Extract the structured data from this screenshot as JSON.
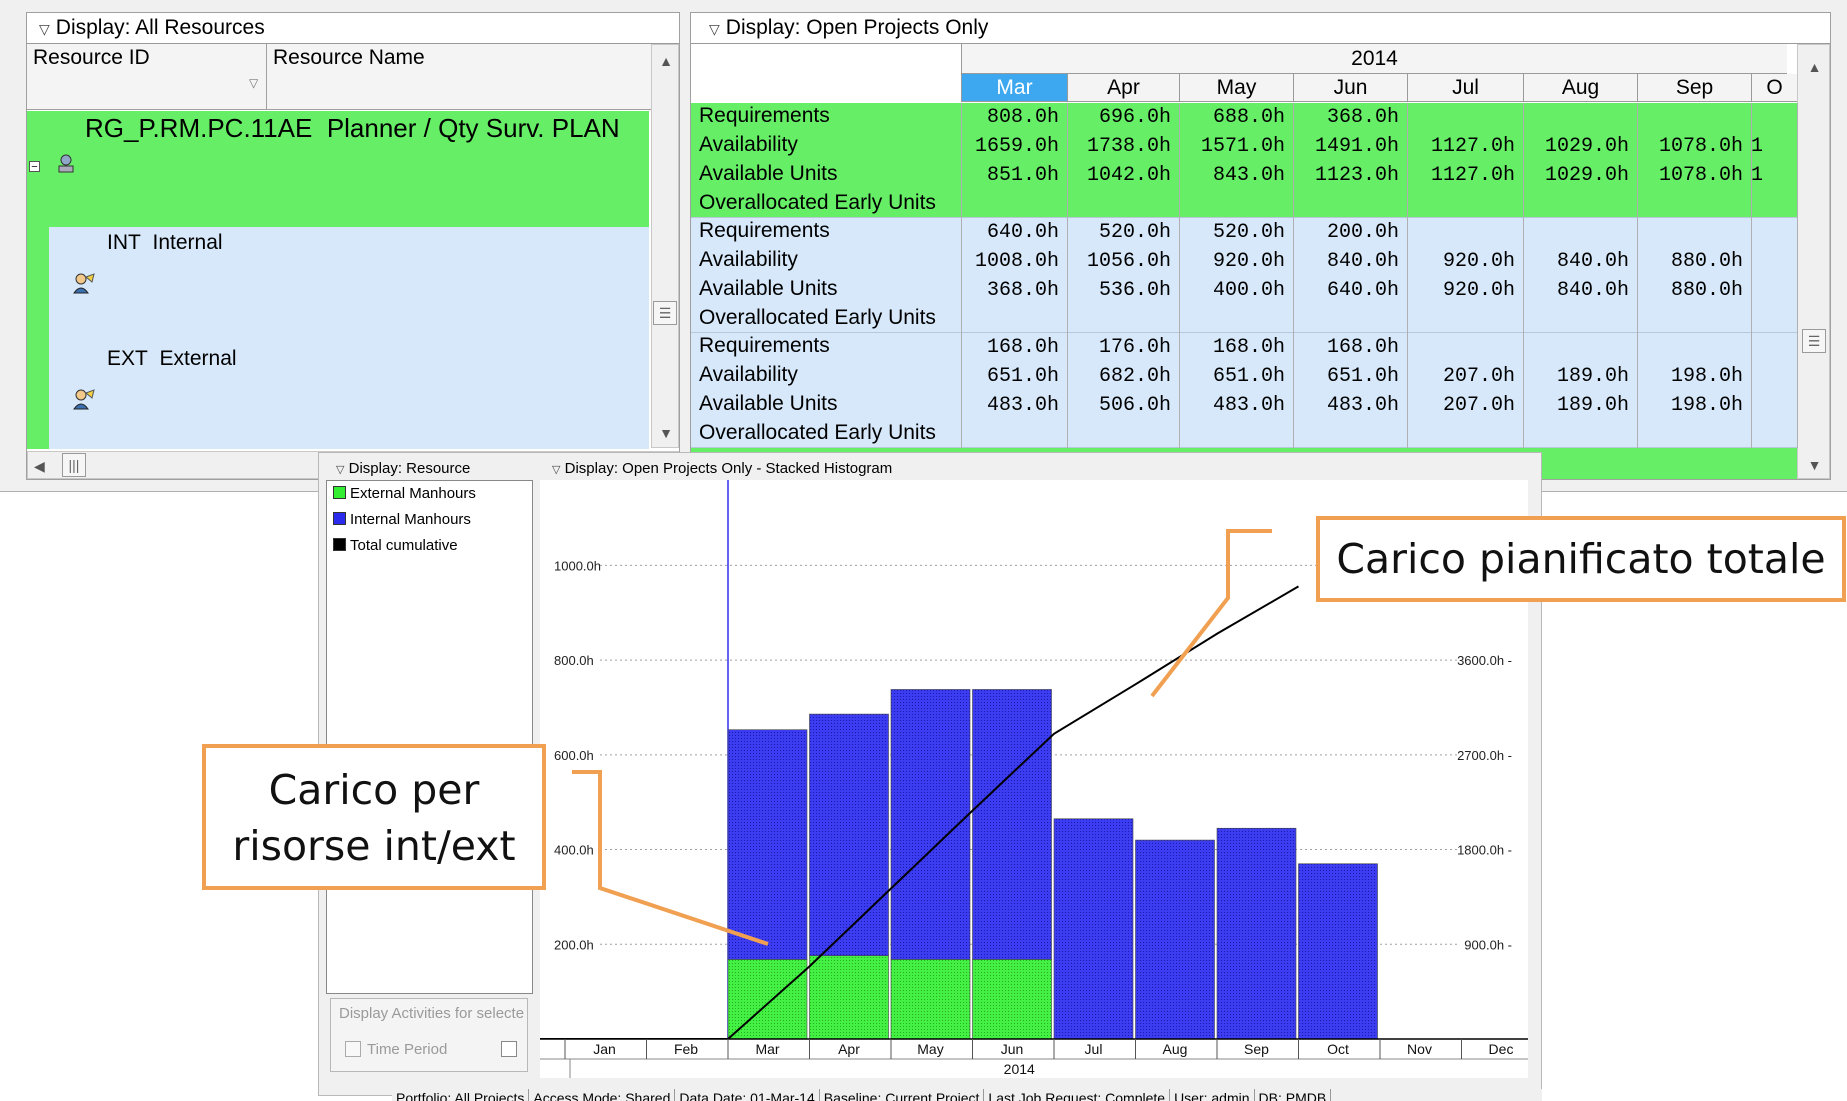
{
  "resource_panel": {
    "header": "Display: All Resources",
    "col_id": "Resource ID",
    "col_name": "Resource Name",
    "rows": [
      {
        "id": "RG_P.RM.PC.11AE",
        "name": "Planner / Qty Surv. PLAN"
      },
      {
        "id": "INT",
        "name": "Internal"
      },
      {
        "id": "EXT",
        "name": "External"
      }
    ]
  },
  "usage_panel": {
    "header": "Display: Open Projects Only",
    "year": "2014",
    "months": [
      "Mar",
      "Apr",
      "May",
      "Jun",
      "Jul",
      "Aug",
      "Sep",
      "O"
    ],
    "labels": [
      "Requirements",
      "Availability",
      "Available Units",
      "Overallocated Early Units"
    ],
    "groups": [
      {
        "rows": [
          [
            "808.0h",
            "696.0h",
            "688.0h",
            "368.0h",
            "",
            "",
            "",
            ""
          ],
          [
            "1659.0h",
            "1738.0h",
            "1571.0h",
            "1491.0h",
            "1127.0h",
            "1029.0h",
            "1078.0h",
            "1"
          ],
          [
            "851.0h",
            "1042.0h",
            "843.0h",
            "1123.0h",
            "1127.0h",
            "1029.0h",
            "1078.0h",
            "1"
          ],
          [
            "",
            "",
            "",
            "",
            "",
            "",
            "",
            ""
          ]
        ]
      },
      {
        "rows": [
          [
            "640.0h",
            "520.0h",
            "520.0h",
            "200.0h",
            "",
            "",
            "",
            ""
          ],
          [
            "1008.0h",
            "1056.0h",
            "920.0h",
            "840.0h",
            "920.0h",
            "840.0h",
            "880.0h",
            ""
          ],
          [
            "368.0h",
            "536.0h",
            "400.0h",
            "640.0h",
            "920.0h",
            "840.0h",
            "880.0h",
            ""
          ],
          [
            "",
            "",
            "",
            "",
            "",
            "",
            "",
            ""
          ]
        ]
      },
      {
        "rows": [
          [
            "168.0h",
            "176.0h",
            "168.0h",
            "168.0h",
            "",
            "",
            "",
            ""
          ],
          [
            "651.0h",
            "682.0h",
            "651.0h",
            "651.0h",
            "207.0h",
            "189.0h",
            "198.0h",
            ""
          ],
          [
            "483.0h",
            "506.0h",
            "483.0h",
            "483.0h",
            "207.0h",
            "189.0h",
            "198.0h",
            ""
          ],
          [
            "",
            "",
            "",
            "",
            "",
            "",
            "",
            ""
          ]
        ]
      }
    ]
  },
  "legend_panel": {
    "header": "Display: Resource",
    "items": [
      {
        "label": "External Manhours",
        "color": "#33ee33"
      },
      {
        "label": "Internal Manhours",
        "color": "#2b2bee"
      },
      {
        "label": "Total cumulative",
        "color": "#000000"
      }
    ],
    "button": "Display Activities for selecte",
    "checkbox": "Time Period"
  },
  "histogram_panel": {
    "header": "Display: Open Projects Only - Stacked Histogram"
  },
  "chart_data": {
    "type": "bar",
    "stacked": true,
    "categories": [
      "Jan",
      "Feb",
      "Mar",
      "Apr",
      "May",
      "Jun",
      "Jul",
      "Aug",
      "Sep",
      "Oct",
      "Nov",
      "Dec"
    ],
    "year_label": "2014",
    "series": [
      {
        "name": "External Manhours",
        "values": [
          0,
          0,
          168,
          176,
          168,
          168,
          0,
          0,
          0,
          0,
          0,
          0
        ]
      },
      {
        "name": "Internal Manhours",
        "values": [
          0,
          0,
          485,
          510,
          570,
          570,
          465,
          420,
          445,
          370,
          0,
          0
        ]
      },
      {
        "name": "Total cumulative",
        "axis": "right",
        "values": [
          0,
          0,
          0,
          690,
          1430,
          2170,
          2900,
          3370,
          3850,
          4300,
          null,
          null
        ]
      }
    ],
    "left_ticks": [
      "200.0h",
      "400.0h",
      "600.0h",
      "800.0h",
      "1000.0h"
    ],
    "left_tick_values": [
      200,
      400,
      600,
      800,
      1000
    ],
    "right_ticks": [
      "900.0h",
      "1800.0h",
      "2700.0h",
      "3600.0h"
    ],
    "right_tick_values": [
      900,
      1800,
      2700,
      3600
    ],
    "ylim": [
      0,
      1100
    ],
    "y2lim": [
      0,
      4950
    ],
    "grid": true
  },
  "callouts": {
    "total": "Carico pianificato totale",
    "per_resource_line1": "Carico per",
    "per_resource_line2": "risorse int/ext"
  },
  "status_bar": [
    "Portfolio: All Projects",
    "Access Mode: Shared",
    "Data Date: 01-Mar-14",
    "Baseline: Current Project",
    "Last Job Request: Complete",
    "User: admin",
    "DB: PMDB"
  ]
}
